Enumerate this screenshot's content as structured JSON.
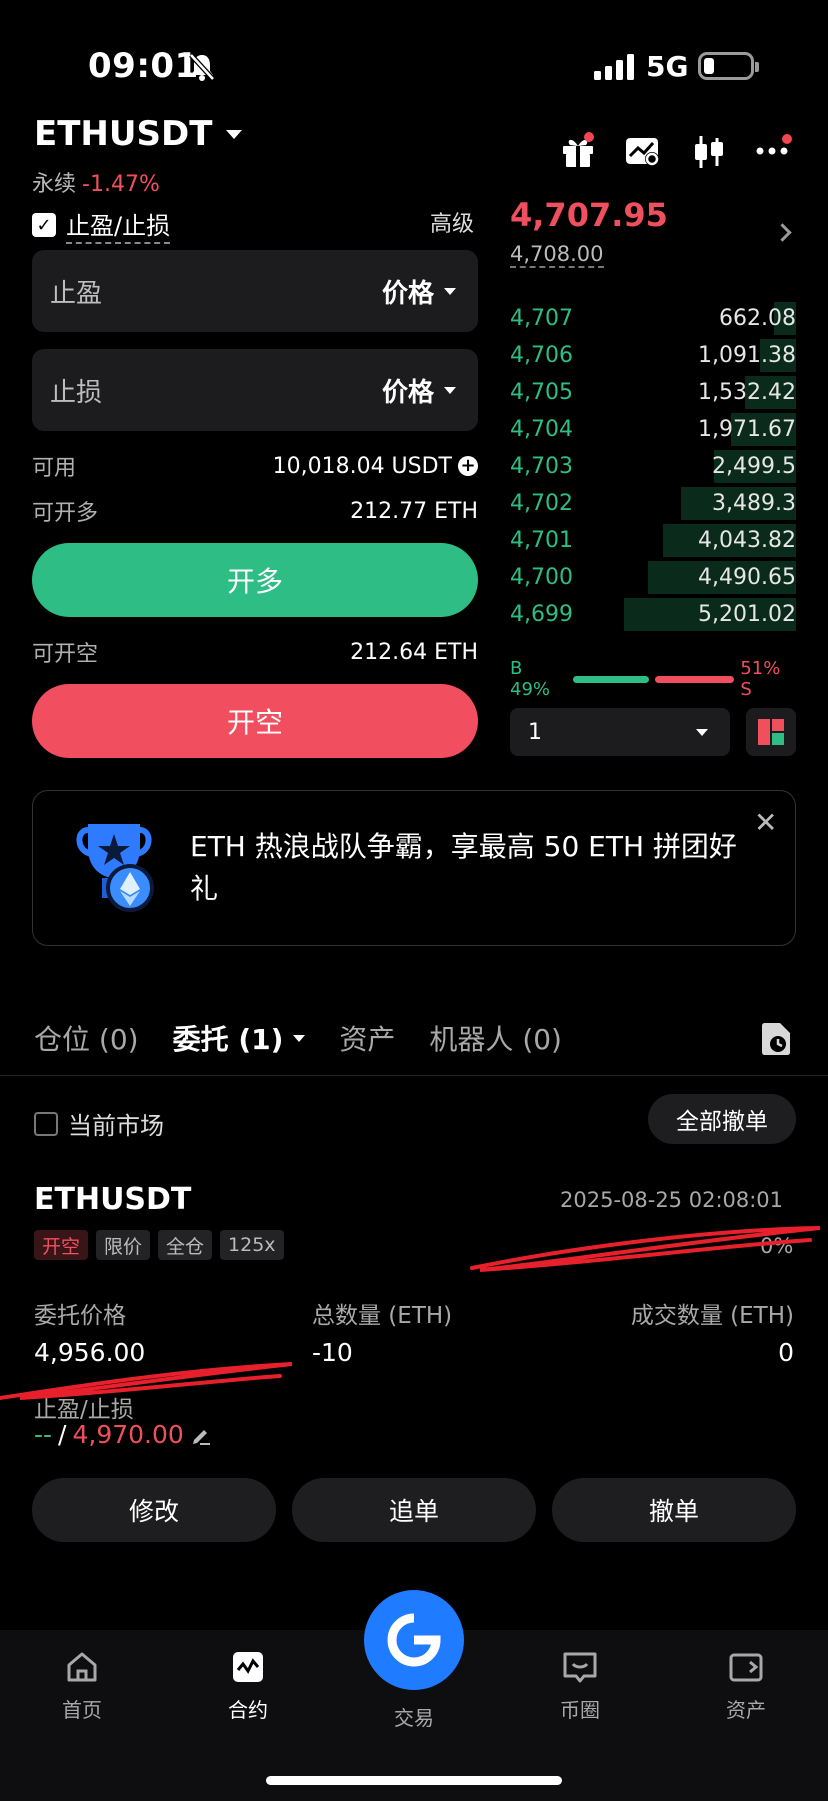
{
  "status": {
    "time": "09:01",
    "network": "5G"
  },
  "header": {
    "symbol": "ETHUSDT",
    "type": "永续",
    "change": "-1.47%"
  },
  "form": {
    "tpsl_label": "止盈/止损",
    "advanced": "高级",
    "tp_label": "止盈",
    "sl_label": "止损",
    "price_select": "价格",
    "available_label": "可用",
    "available_value": "10,018.04 USDT",
    "can_long_label": "可开多",
    "can_long_value": "212.77 ETH",
    "long_button": "开多",
    "can_short_label": "可开空",
    "can_short_value": "212.64 ETH",
    "short_button": "开空"
  },
  "orderbook": {
    "last_price": "4,707.95",
    "mark_price": "4,708.00",
    "bids": [
      {
        "price": "4,707",
        "qty": "662.08"
      },
      {
        "price": "4,706",
        "qty": "1,091.38"
      },
      {
        "price": "4,705",
        "qty": "1,532.42"
      },
      {
        "price": "4,704",
        "qty": "1,971.67"
      },
      {
        "price": "4,703",
        "qty": "2,499.5"
      },
      {
        "price": "4,702",
        "qty": "3,489.3"
      },
      {
        "price": "4,701",
        "qty": "4,043.82"
      },
      {
        "price": "4,700",
        "qty": "4,490.65"
      },
      {
        "price": "4,699",
        "qty": "5,201.02"
      }
    ],
    "buy_ratio": "B 49%",
    "sell_ratio": "51% S",
    "buy_fraction": 0.49,
    "precision": "1"
  },
  "banner": {
    "text": "ETH 热浪战队争霸，享最高 50 ETH 拼团好礼"
  },
  "tabs": {
    "positions": "仓位 (0)",
    "orders": "委托 (1)",
    "assets": "资产",
    "bots": "机器人 (0)"
  },
  "orders": {
    "current_market": "当前市场",
    "cancel_all": "全部撤单",
    "item": {
      "symbol": "ETHUSDT",
      "time": "2025-08-25 02:08:01",
      "tags": [
        "开空",
        "限价",
        "全仓",
        "125x"
      ],
      "fill_pct": "0%",
      "price_label": "委托价格",
      "price_value": "4,956.00",
      "qty_label": "总数量 (ETH)",
      "qty_value": "-10",
      "filled_label": "成交数量 (ETH)",
      "filled_value": "0",
      "tpsl_label": "止盈/止损",
      "tp_value": "--",
      "slash": "/",
      "sl_value": "4,970.00",
      "modify": "修改",
      "chase": "追单",
      "cancel": "撤单"
    }
  },
  "nav": {
    "home": "首页",
    "futures": "合约",
    "trade": "交易",
    "circle": "币圈",
    "assets": "资产"
  },
  "colors": {
    "green": "#2ebd85",
    "red": "#f14f5f",
    "fab": "#1f7bff"
  }
}
